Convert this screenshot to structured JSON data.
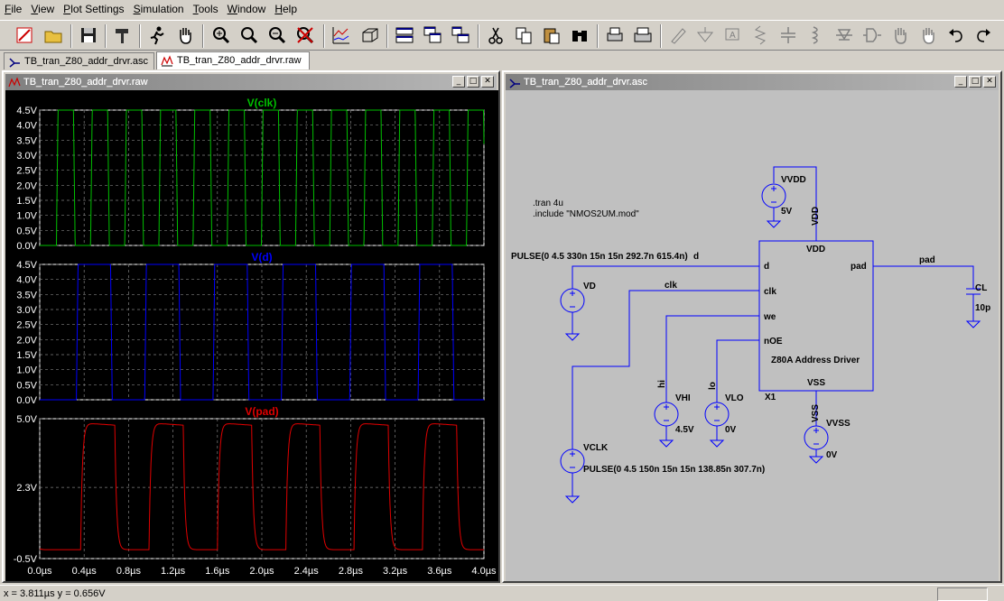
{
  "menu": [
    {
      "u": "F",
      "rest": "ile"
    },
    {
      "u": "V",
      "rest": "iew"
    },
    {
      "u": "P",
      "rest": "lot Settings"
    },
    {
      "u": "S",
      "rest": "imulation"
    },
    {
      "u": "T",
      "rest": "ools"
    },
    {
      "u": "W",
      "rest": "indow"
    },
    {
      "u": "H",
      "rest": "elp"
    }
  ],
  "tabs": [
    {
      "label": "TB_tran_Z80_addr_drvr.asc",
      "icon": "schematic-icon"
    },
    {
      "label": "TB_tran_Z80_addr_drvr.raw",
      "icon": "waveform-icon"
    }
  ],
  "waveform_window": {
    "title": "TB_tran_Z80_addr_drvr.raw",
    "min": "_",
    "restore": "□",
    "close": "✕"
  },
  "schematic_window": {
    "title": "TB_tran_Z80_addr_drvr.asc",
    "min": "_",
    "restore": "□",
    "close": "✕"
  },
  "status": {
    "cursor": "x = 3.811µs   y = 0.656V"
  },
  "chart_data": [
    {
      "type": "line",
      "title": "V(clk)",
      "color": "#00c000",
      "ylim": [
        0,
        4.5
      ],
      "yticks": [
        "4.5V",
        "4.0V",
        "3.5V",
        "3.0V",
        "2.5V",
        "2.0V",
        "1.5V",
        "1.0V",
        "0.5V",
        "0.0V"
      ],
      "description_of_signal": "square wave 0 to 4.5V, period 307.7n, rising at 150n",
      "pulse": {
        "v1": 0,
        "v2": 4.5,
        "td": 150,
        "tr": 15,
        "tf": 15,
        "ton": 138.85,
        "period": 307.7
      }
    },
    {
      "type": "line",
      "title": "V(d)",
      "color": "#0000ff",
      "ylim": [
        0,
        4.5
      ],
      "yticks": [
        "4.5V",
        "4.0V",
        "3.5V",
        "3.0V",
        "2.5V",
        "2.0V",
        "1.5V",
        "1.0V",
        "0.5V",
        "0.0V"
      ],
      "pulse": {
        "v1": 0,
        "v2": 4.5,
        "td": 330,
        "tr": 15,
        "tf": 15,
        "ton": 292.7,
        "period": 615.4
      }
    },
    {
      "type": "line",
      "title": "V(pad)",
      "color": "#e00000",
      "ylim": [
        -0.5,
        5.0
      ],
      "yticks": [
        "5.0V",
        "2.3V",
        "-0.5V"
      ],
      "xlim": [
        0,
        4.0
      ],
      "xticks": [
        "0.0µs",
        "0.4µs",
        "0.8µs",
        "1.2µs",
        "1.6µs",
        "2.0µs",
        "2.4µs",
        "2.8µs",
        "3.2µs",
        "3.6µs",
        "4.0µs"
      ]
    }
  ],
  "schematic": {
    "directives": [
      ".tran 4u",
      ".include \"NMOS2UM.mod\""
    ],
    "vd_pulse": "PULSE(0 4.5 330n 15n 15n 292.7n 615.4n)",
    "vclk_pulse": "PULSE(0 4.5 150n 15n 15n 138.85n 307.7n)",
    "block_name": "Z80A Address Driver",
    "block_inst": "X1",
    "pins": {
      "vdd": "VDD",
      "d": "d",
      "clk": "clk",
      "we": "we",
      "noe": "nOE",
      "vss": "VSS",
      "pad": "pad"
    },
    "net_labels": {
      "d": "d",
      "clk": "clk",
      "pad": "pad",
      "hi": "hi",
      "lo": "lo",
      "vdd": "VDD",
      "vss": "VSS"
    },
    "sources": {
      "vvdd": {
        "name": "VVDD",
        "value": "5V"
      },
      "vd": {
        "name": "VD"
      },
      "vhi": {
        "name": "VHI",
        "value": "4.5V"
      },
      "vlo": {
        "name": "VLO",
        "value": "0V"
      },
      "vvss": {
        "name": "VVSS",
        "value": "0V"
      },
      "vclk": {
        "name": "VCLK"
      }
    },
    "cap": {
      "name": "CL",
      "value": "10p"
    }
  }
}
